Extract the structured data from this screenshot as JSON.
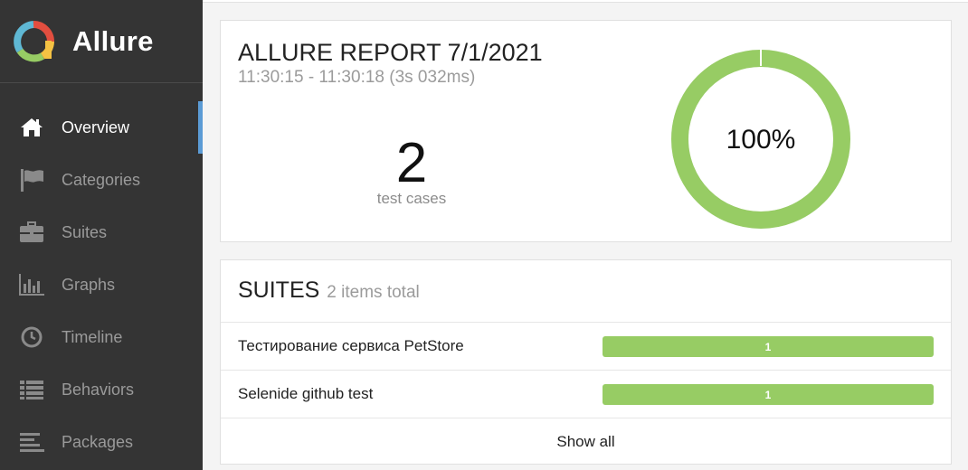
{
  "brand": {
    "name": "Allure",
    "logo_icon": "allure-logo-icon"
  },
  "nav": {
    "items": [
      {
        "label": "Overview",
        "icon": "home-icon",
        "active": true
      },
      {
        "label": "Categories",
        "icon": "flag-icon",
        "active": false
      },
      {
        "label": "Suites",
        "icon": "briefcase-icon",
        "active": false
      },
      {
        "label": "Graphs",
        "icon": "bar-chart-icon",
        "active": false
      },
      {
        "label": "Timeline",
        "icon": "clock-icon",
        "active": false
      },
      {
        "label": "Behaviors",
        "icon": "list-icon",
        "active": false
      },
      {
        "label": "Packages",
        "icon": "align-left-icon",
        "active": false
      }
    ]
  },
  "overview": {
    "title": "ALLURE REPORT 7/1/2021",
    "time_range": "11:30:15 - 11:30:18 (3s 032ms)",
    "test_count": "2",
    "test_count_label": "test cases",
    "pass_percent_label": "100%",
    "pass_fraction": 1.0
  },
  "suites": {
    "title": "SUITES",
    "count_label": "2 items total",
    "rows": [
      {
        "name": "Тестирование сервиса PetStore",
        "passed": "1"
      },
      {
        "name": "Selenide github test",
        "passed": "1"
      }
    ],
    "show_all_label": "Show all"
  },
  "colors": {
    "sidebar_bg": "#343434",
    "passed": "#97cc64",
    "active_marker": "#5b9bd5"
  }
}
